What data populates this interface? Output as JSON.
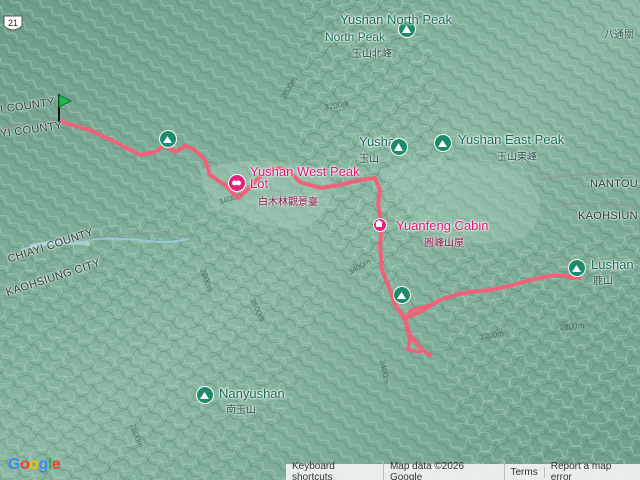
{
  "map": {
    "route_number": "21",
    "counties": {
      "chiayi_upper": "I COUNTY",
      "chiayi_lower": "YI COUNTY",
      "chiayi_mid": "CHIAYI COUNTY",
      "kaohsiung_city": "KAOHSIUNG CITY",
      "nantou": "NANTOU",
      "kaohsiung_right": "KAOHSIUN"
    },
    "places": {
      "yushan_north": {
        "en": "Yushan North Peak",
        "zh": "玉山北峰"
      },
      "yushan": {
        "en": "Yushan",
        "zh": "玉山"
      },
      "yushan_east": {
        "en": "Yushan East Peak",
        "zh": "玉山東峰"
      },
      "yushan_west": {
        "en": "Yushan West Peak Lot",
        "zh": "白木林觀景臺"
      },
      "yuanfeng_cabin": {
        "en": "Yuanfeng Cabin",
        "zh": "圓峰山屋"
      },
      "lushan": {
        "en": "Lushan",
        "zh": "鹿山"
      },
      "nanyushan": {
        "en": "Nanyushan",
        "zh": "南玉山"
      },
      "batongguan": {
        "zh": "八通關"
      }
    },
    "contours": [
      "2800m",
      "3400m",
      "2800m",
      "3400m",
      "3200m",
      "2800m",
      "2800m",
      "3400m",
      "3200m",
      "3600m"
    ],
    "route_color": "#f0627a",
    "poi_color": "#1e8c6a",
    "cabin_color": "#e0247a"
  },
  "footer": {
    "google": [
      "G",
      "o",
      "o",
      "g",
      "l",
      "e"
    ],
    "shortcuts": "Keyboard shortcuts",
    "mapdata": "Map data ©2026 Google",
    "terms": "Terms",
    "report": "Report a map error"
  }
}
